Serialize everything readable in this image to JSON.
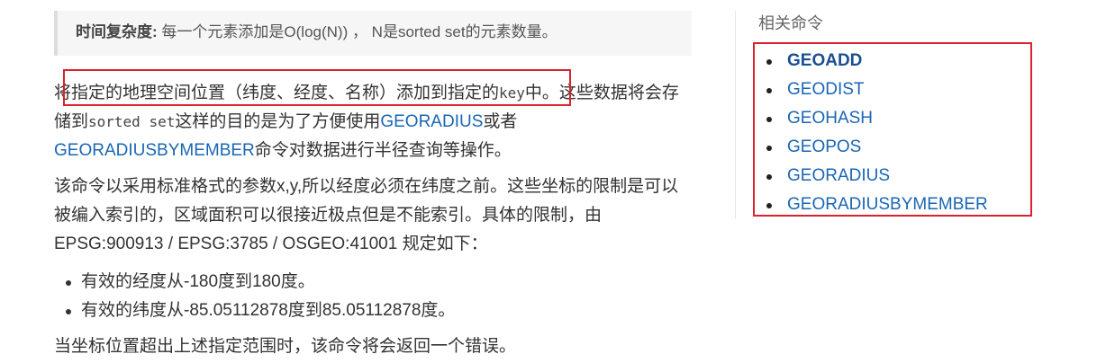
{
  "complexity": {
    "label": "时间复杂度:",
    "text": "每一个元素添加是O(log(N)) ， N是sorted set的元素数量。"
  },
  "description": {
    "p1_text_1": "将指定的地理空间位置（纬度、经度、名称）添加到指定的",
    "p1_code_1": "key",
    "p1_text_2": "中。这些数据将会存储到",
    "p1_code_2": "sorted set",
    "p1_text_3": "这样的目的是为了方便使用",
    "p1_link_1": "GEORADIUS",
    "p1_text_4": "或者",
    "p1_link_2": "GEORADIUSBYMEMBER",
    "p1_text_5": "命令对数据进行半径查询等操作。",
    "p2": "该命令以采用标准格式的参数x,y,所以经度必须在纬度之前。这些坐标的限制是可以被编入索引的，区域面积可以很接近极点但是不能索引。具体的限制，由EPSG:900913 / EPSG:3785 / OSGEO:41001 规定如下：",
    "bullets": [
      "有效的经度从-180度到180度。",
      "有效的纬度从-85.05112878度到85.05112878度。"
    ],
    "p3": "当坐标位置超出上述指定范围时，该命令将会返回一个错误。"
  },
  "sidebar": {
    "heading": "相关命令",
    "items": [
      "GEOADD",
      "GEODIST",
      "GEOHASH",
      "GEOPOS",
      "GEORADIUS",
      "GEORADIUSBYMEMBER"
    ]
  },
  "colors": {
    "link": "#1a66b4",
    "highlight_border": "#d9232e",
    "note_background": "#f6f6f6"
  }
}
